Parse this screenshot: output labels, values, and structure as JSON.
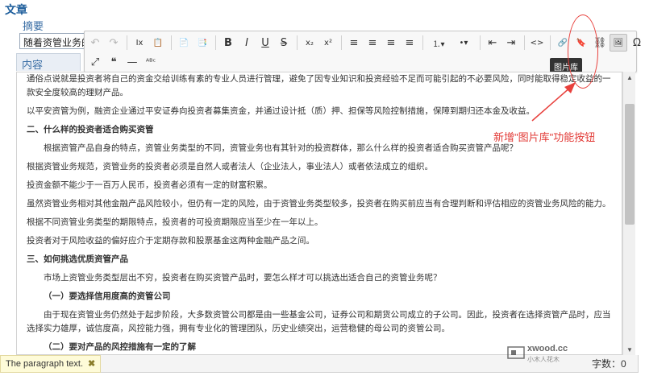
{
  "section_title": "文章",
  "abstract": {
    "label": "摘要",
    "value": "随着资管业务的"
  },
  "content_label": "内容",
  "toolbar": {
    "row1": [
      {
        "name": "undo-button",
        "glyph": "↶",
        "disabled": true
      },
      {
        "name": "redo-button",
        "glyph": "↷",
        "disabled": true
      },
      {
        "name": "sep"
      },
      {
        "name": "remove-format-button",
        "glyph": "Ix"
      },
      {
        "name": "paste-button",
        "glyph": "📋"
      },
      {
        "name": "sep"
      },
      {
        "name": "paste-plain-button",
        "glyph": "📄"
      },
      {
        "name": "paste-word-button",
        "glyph": "📑"
      },
      {
        "name": "sep"
      },
      {
        "name": "bold-button",
        "glyph": "B"
      },
      {
        "name": "italic-button",
        "glyph": "I"
      },
      {
        "name": "underline-button",
        "glyph": "U"
      },
      {
        "name": "strike-button",
        "glyph": "S"
      },
      {
        "name": "sep"
      },
      {
        "name": "subscript-button",
        "glyph": "x₂"
      },
      {
        "name": "superscript-button",
        "glyph": "x²"
      },
      {
        "name": "sep"
      },
      {
        "name": "align-left-button",
        "glyph": "≡"
      },
      {
        "name": "align-center-button",
        "glyph": "≡"
      },
      {
        "name": "align-right-button",
        "glyph": "≡"
      },
      {
        "name": "align-justify-button",
        "glyph": "≡"
      },
      {
        "name": "sep"
      },
      {
        "name": "numbered-list-button",
        "glyph": "⒈▾",
        "wide": true
      },
      {
        "name": "bullet-list-button",
        "glyph": "•▾",
        "wide": true
      },
      {
        "name": "sep"
      },
      {
        "name": "outdent-button",
        "glyph": "⇤"
      },
      {
        "name": "indent-button",
        "glyph": "⇥"
      },
      {
        "name": "sep"
      },
      {
        "name": "source-code-button",
        "glyph": "<>"
      },
      {
        "name": "sep"
      },
      {
        "name": "link-button",
        "glyph": "🔗"
      },
      {
        "name": "bookmark-button",
        "glyph": "🔖"
      },
      {
        "name": "unlink-button",
        "glyph": "⛓"
      },
      {
        "name": "image-library-button",
        "glyph": "🖼",
        "active": true
      },
      {
        "name": "special-char-button",
        "glyph": "Ω"
      },
      {
        "name": "sep"
      },
      {
        "name": "print-button",
        "glyph": "🖨"
      }
    ],
    "row2": [
      {
        "name": "fullscreen-button",
        "glyph": "⤢"
      },
      {
        "name": "blockquote-button",
        "glyph": "❝"
      },
      {
        "name": "horizontal-rule-button",
        "glyph": "—"
      },
      {
        "name": "spellcheck-button",
        "glyph": "ᴬᴮᶜ"
      }
    ],
    "tooltip": "图片库"
  },
  "paragraphs": [
    {
      "text": "通俗点说就是投资者将自己的资金交给训练有素的专业人员进行管理，避免了因专业知识和投资经验不足而可能引起的不必要风险，同时能取得稳定收益的一款安全度较高的理财产品。",
      "cls": ""
    },
    {
      "text": "以平安资管为例，融资企业通过平安证券向投资者募集资金，并通过设计抵（质）押、担保等风险控制措施，保障到期归还本金及收益。",
      "cls": "gap"
    },
    {
      "text": "二、什么样的投资者适合购买资管",
      "cls": "gap heading"
    },
    {
      "text": "根据资管产品自身的特点，资管业务类型的不同，资管业务也有其针对的投资群体，那么什么样的投资者适合购买资管产品呢？",
      "cls": "gap indent"
    },
    {
      "text": "根据资管业务规范，资管业务的投资者必须是自然人或者法人（企业法人，事业法人）或者依法成立的组织。",
      "cls": "gap"
    },
    {
      "text": "投资金额不能少于一百万人民币，投资者必须有一定的财富积累。",
      "cls": "gap"
    },
    {
      "text": "虽然资管业务相对其他金融产品风险较小，但仍有一定的风险，由于资管业务类型较多，投资者在购买前应当有合理判断和评估相应的资管业务风险的能力。",
      "cls": "gap"
    },
    {
      "text": "根据不同资管业务类型的期限特点，投资者的可投资期限应当至少在一年以上。",
      "cls": "gap"
    },
    {
      "text": "投资者对于风险收益的偏好应介于定期存款和股票基金这两种金融产品之间。",
      "cls": "gap"
    },
    {
      "text": "三、如何挑选优质资管产品",
      "cls": "gap heading"
    },
    {
      "text": "市场上资管业务类型层出不穷，投资者在购买资管产品时，要怎么样才可以挑选出适合自己的资管业务呢？",
      "cls": "gap indent"
    },
    {
      "text": "（一）要选择信用度高的资管公司",
      "cls": "gap indent heading"
    },
    {
      "text": "由于现在资管业务仍然处于起步阶段，大多数资管公司都是由一些基金公司，证券公司和期货公司成立的子公司。因此，投资者在选择资管产品时，应当选择实力雄厚，诚信度高，风控能力强，拥有专业化的管理团队，历史业绩突出，运营稳健的母公司的资管公司。",
      "cls": "gap indent"
    },
    {
      "text": "（二）要对产品的风控措施有一定的了解",
      "cls": "gap indent heading"
    }
  ],
  "status": {
    "path_text": "The paragraph text.",
    "close_glyph": "✖",
    "word_count": "字数：0"
  },
  "annotation": {
    "text": "新增\"图片库\"功能按钮",
    "color": "#e23b37"
  },
  "watermark": {
    "text": "xwood.cc",
    "sub": "小木人花木"
  }
}
